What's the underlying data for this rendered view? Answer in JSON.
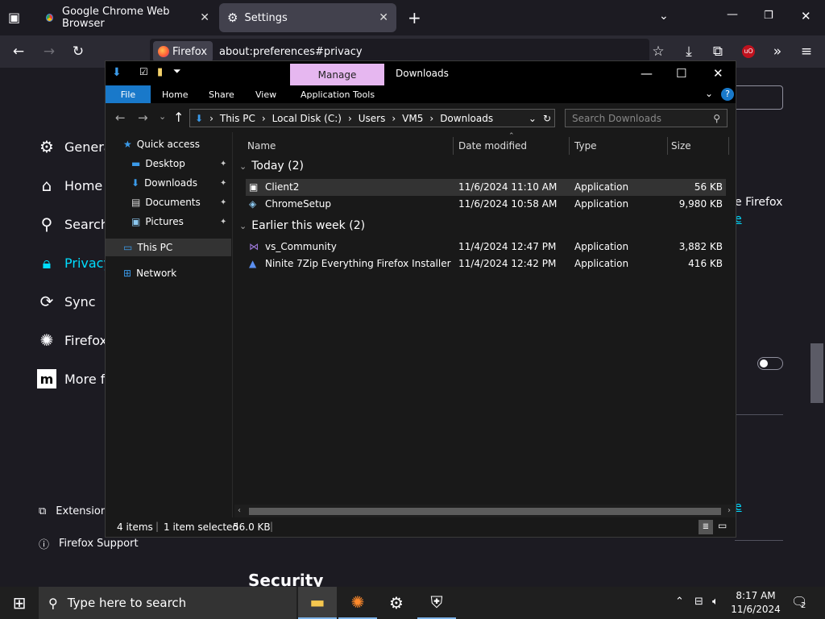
{
  "browser": {
    "tabs": [
      {
        "label": "Google Chrome Web Browser"
      },
      {
        "label": "Settings"
      }
    ],
    "identity_label": "Firefox",
    "url": "about:preferences#privacy"
  },
  "settings_nav": {
    "items": [
      {
        "label": "Genera",
        "icon": "gear-icon"
      },
      {
        "label": "Home",
        "icon": "home-icon"
      },
      {
        "label": "Search",
        "icon": "search-icon"
      },
      {
        "label": "Privacy",
        "icon": "lock-icon"
      },
      {
        "label": "Sync",
        "icon": "sync-icon"
      },
      {
        "label": "Firefox",
        "icon": "firefox-icon"
      },
      {
        "label": "More fr",
        "icon": "mozilla-icon"
      }
    ],
    "footer": [
      {
        "label": "Extension",
        "icon": "puzzle-icon"
      },
      {
        "label": "Firefox Support",
        "icon": "help-icon"
      }
    ],
    "right_fragments": [
      "e Firefox",
      "e",
      "e"
    ],
    "section_heading": "Security"
  },
  "explorer": {
    "context_tab": "Manage",
    "title": "Downloads",
    "ribbon_tabs": [
      "File",
      "Home",
      "Share",
      "View",
      "Application Tools"
    ],
    "breadcrumb": [
      "This PC",
      "Local Disk (C:)",
      "Users",
      "VM5",
      "Downloads"
    ],
    "search_placeholder": "Search Downloads",
    "nav_items": [
      {
        "label": "Quick access",
        "icon": "star-icon"
      },
      {
        "label": "Desktop",
        "icon": "desktop-icon"
      },
      {
        "label": "Downloads",
        "icon": "download-arrow-icon"
      },
      {
        "label": "Documents",
        "icon": "document-icon"
      },
      {
        "label": "Pictures",
        "icon": "pictures-icon"
      },
      {
        "label": "This PC",
        "icon": "computer-icon"
      },
      {
        "label": "Network",
        "icon": "network-icon"
      }
    ],
    "columns": [
      "Name",
      "Date modified",
      "Type",
      "Size"
    ],
    "groups": [
      {
        "label": "Today (2)",
        "files": [
          {
            "name": "Client2",
            "date": "11/6/2024 11:10 AM",
            "type": "Application",
            "size": "56 KB"
          },
          {
            "name": "ChromeSetup",
            "date": "11/6/2024 10:58 AM",
            "type": "Application",
            "size": "9,980 KB"
          }
        ]
      },
      {
        "label": "Earlier this week (2)",
        "files": [
          {
            "name": "vs_Community",
            "date": "11/4/2024 12:47 PM",
            "type": "Application",
            "size": "3,882 KB"
          },
          {
            "name": "Ninite 7Zip Everything Firefox Installer",
            "date": "11/4/2024 12:42 PM",
            "type": "Application",
            "size": "416 KB"
          }
        ]
      }
    ],
    "status": {
      "items": "4 items",
      "selected": "1 item selected",
      "size": "56.0 KB"
    }
  },
  "taskbar": {
    "search_placeholder": "Type here to search",
    "time": "8:17 AM",
    "date": "11/6/2024",
    "notification_count": "2"
  },
  "colors": {
    "accent": "#1979ca",
    "manage_tab": "#e6b7f0",
    "privacy": "#00ddff"
  }
}
